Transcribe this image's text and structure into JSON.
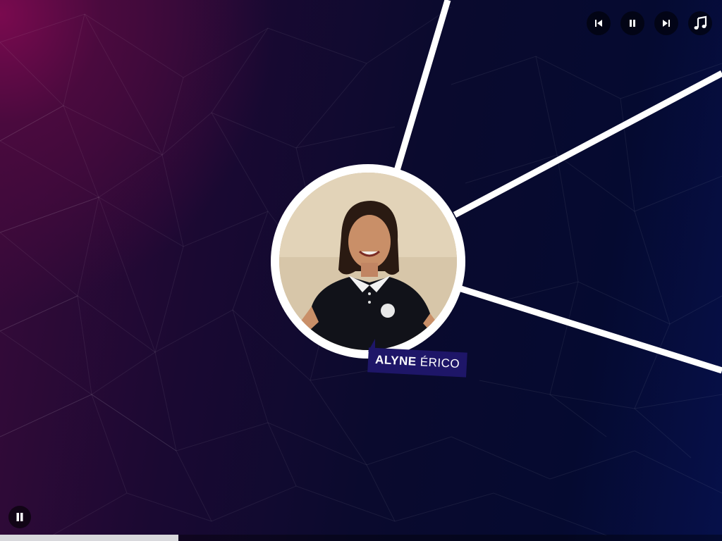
{
  "person": {
    "first_name": "ALYNE",
    "last_name": "ÉRICO",
    "photo_icon": "person-photo"
  },
  "top_controls": [
    {
      "name": "previous-button",
      "icon": "skip-previous-icon"
    },
    {
      "name": "pause-button",
      "icon": "pause-icon"
    },
    {
      "name": "next-button",
      "icon": "skip-next-icon"
    },
    {
      "name": "music-button",
      "icon": "music-note-icon"
    }
  ],
  "playback": {
    "progress_fraction": 0.247,
    "bottom_button_icon": "pause-icon"
  },
  "colors": {
    "name_tag_bg": "#1e1668",
    "accent_magenta": "#7a0a4f",
    "deep_navy": "#070a2a",
    "line_white": "#ffffff"
  }
}
